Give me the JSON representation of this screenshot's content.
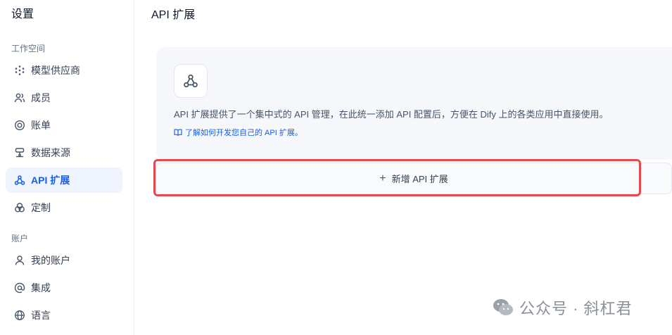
{
  "sidebar": {
    "title": "设置",
    "workspace_label": "工作空间",
    "account_label": "账户",
    "workspace_items": [
      {
        "label": "模型供应商",
        "icon": "cube-dots-icon"
      },
      {
        "label": "成员",
        "icon": "users-icon"
      },
      {
        "label": "账单",
        "icon": "coin-icon"
      },
      {
        "label": "数据来源",
        "icon": "database-icon"
      },
      {
        "label": "API 扩展",
        "icon": "webhook-icon",
        "active": true
      },
      {
        "label": "定制",
        "icon": "palette-icon"
      }
    ],
    "account_items": [
      {
        "label": "我的账户",
        "icon": "user-icon"
      },
      {
        "label": "集成",
        "icon": "at-sign-icon"
      },
      {
        "label": "语言",
        "icon": "globe-icon"
      }
    ]
  },
  "main": {
    "title": "API 扩展",
    "intro": "API 扩展提供了一个集中式的 API 管理，在此统一添加 API 配置后，方便在 Dify 上的各类应用中直接使用。",
    "doc_link": "了解如何开发您自己的 API 扩展。",
    "add_button_label": "新增 API 扩展"
  },
  "watermark": "公众号 · 斜杠君",
  "colors": {
    "accent": "#155eef",
    "highlight": "#e5484d",
    "card_bg": "#f5f7fa"
  }
}
